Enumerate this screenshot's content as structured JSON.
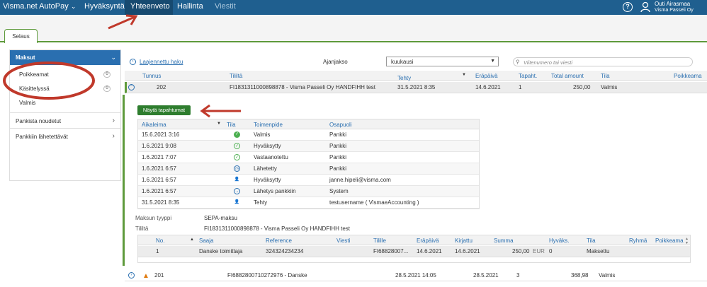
{
  "topbar": {
    "brand": "Visma.net AutoPay",
    "brand_chevron": "⌄",
    "nav": [
      "Hyväksyntä",
      "Yhteenveto",
      "Hallinta",
      "Viestit"
    ],
    "help_icon": "?",
    "user_name": "Outi Airasmaa",
    "user_org": "Visma Passeli Oy"
  },
  "tabs": {
    "browse": "Selaus"
  },
  "sidebar": {
    "header": "Maksut",
    "sub_items": [
      {
        "label": "Poikkeamat",
        "count": "0"
      },
      {
        "label": "Käsittelyssä",
        "count": "0"
      },
      {
        "label": "Valmis"
      }
    ],
    "items": [
      "Pankista noudetut",
      "Pankkiin lähetettävät"
    ]
  },
  "filters": {
    "advanced_search": "Laajennettu haku",
    "period_label": "Ajanjakso",
    "period_value": "kuukausi",
    "search_placeholder": "Viitenumero tai viesti"
  },
  "grid": {
    "columns": [
      "Tunnus",
      "Tililtä",
      "Tehty",
      "Eräpäivä",
      "Tapaht.",
      "Total amount",
      "Tila",
      "Poikkeama"
    ],
    "rows": [
      {
        "id": "202",
        "account": "FI1831311000898878 - Visma Passeli Oy HANDFIHH test",
        "created": "31.5.2021 8:35",
        "due": "14.6.2021",
        "events": "1",
        "total": "250,00",
        "status": "Valmis"
      },
      {
        "id": "201",
        "account": "FI6882800710272976 - Danske",
        "created": "28.5.2021 14:05",
        "due": "28.5.2021",
        "events": "3",
        "total": "368,98",
        "status": "Valmis"
      }
    ]
  },
  "details": {
    "show_events_button": "Näytä tapahtumat",
    "event_columns": [
      "Aikaleima",
      "Tila",
      "Toimenpide",
      "Osapuoli"
    ],
    "events": [
      {
        "time": "15.6.2021 3:16",
        "icon": "check-filled-icon",
        "action": "Valmis",
        "party": "Pankki"
      },
      {
        "time": "1.6.2021 9:08",
        "icon": "check-outline-icon",
        "action": "Hyväksytty",
        "party": "Pankki"
      },
      {
        "time": "1.6.2021 7:07",
        "icon": "check-outline-icon",
        "action": "Vastaanotettu",
        "party": "Pankki"
      },
      {
        "time": "1.6.2021 6:57",
        "icon": "clock-icon",
        "action": "Lähetetty",
        "party": "Pankki"
      },
      {
        "time": "1.6.2021 6:57",
        "icon": "user-check-icon",
        "action": "Hyväksytty",
        "party": "janne.hipeli@visma.com"
      },
      {
        "time": "1.6.2021 6:57",
        "icon": "arrow-right-circle-icon",
        "action": "Lähetys pankkiin",
        "party": "System"
      },
      {
        "time": "31.5.2021 8:35",
        "icon": "user-icon",
        "action": "Tehty",
        "party": "testusername ( VismaeAccounting )"
      }
    ],
    "payment_type_label": "Maksun tyyppi",
    "payment_type_value": "SEPA-maksu",
    "from_account_label": "Tililtä",
    "from_account_value": "FI1831311000898878 - Visma Passeli Oy HANDFIHH test",
    "payment_columns": [
      "No.",
      "Saaja",
      "Reference",
      "Viesti",
      "Tilille",
      "Eräpäivä",
      "Kirjattu",
      "Summa",
      "Hyväks.",
      "Tila",
      "Ryhmä",
      "Poikkeama"
    ],
    "payment_row": {
      "no": "1",
      "payee": "Danske toimittaja",
      "reference": "324324234234",
      "message": "",
      "to_account": "FI68828007...",
      "due": "14.6.2021",
      "booked": "14.6.2021",
      "amount": "250,00",
      "currency": "EUR",
      "approvals": "0",
      "status": "Maksettu"
    }
  },
  "colors": {
    "brand_blue": "#1f5f8f",
    "accent_green": "#5e9a3b",
    "link_blue": "#2a6fb0",
    "annotation_red": "#c0392b"
  }
}
